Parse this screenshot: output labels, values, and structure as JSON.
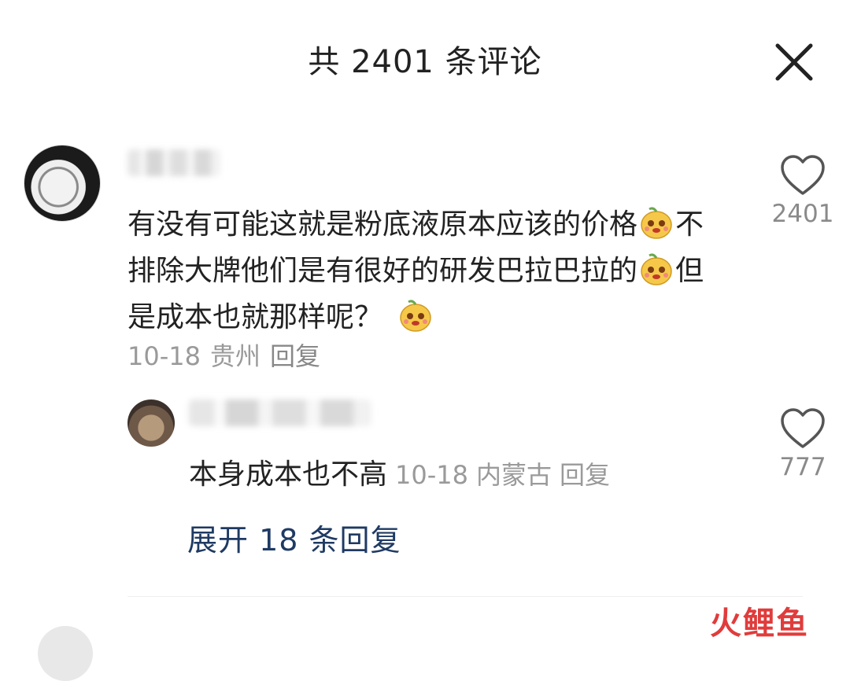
{
  "header": {
    "title": "共 2401 条评论"
  },
  "comment": {
    "text_parts": [
      "有没有可能这就是粉底液原本应该的价格",
      "不排除大牌他们是有很好的研发巴拉巴拉的",
      "但是成本也就那样呢？"
    ],
    "date": "10-18",
    "location": "贵州",
    "reply_label": "回复",
    "like_count": "2401"
  },
  "reply": {
    "text": "本身成本也不高",
    "date": "10-18",
    "location": "内蒙古",
    "reply_label": "回复",
    "like_count": "777"
  },
  "expand_label": "展开 18 条回复",
  "watermark": "火鲤鱼",
  "icons": [
    "close-icon",
    "heart-icon",
    "emoji-icon"
  ]
}
